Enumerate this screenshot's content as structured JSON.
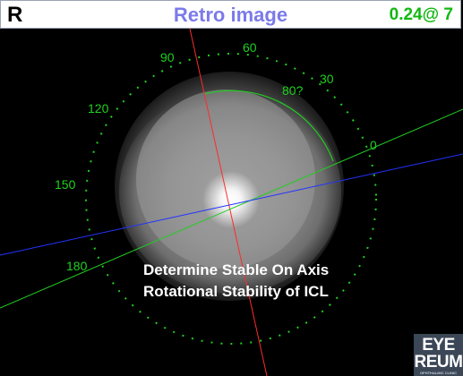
{
  "header": {
    "eye_label": "R",
    "title": "Retro image",
    "reading": "0.24@  7"
  },
  "protractor": {
    "labels": [
      "60",
      "90",
      "30",
      "80?",
      "120",
      "0",
      "150",
      "180"
    ]
  },
  "caption": {
    "line1": "Determine Stable On Axis",
    "line2": "Rotational  Stability  of ICL"
  },
  "logo": {
    "line1": "EYE",
    "line2": "REUM",
    "line3": "OPHTHALMIC CLINIC"
  },
  "colors": {
    "title": "#7b7bea",
    "reading": "#12b812",
    "scale": "#1fd11f",
    "axis_red": "#ff2a2a",
    "axis_green": "#22cc22",
    "axis_blue": "#2233ff"
  }
}
